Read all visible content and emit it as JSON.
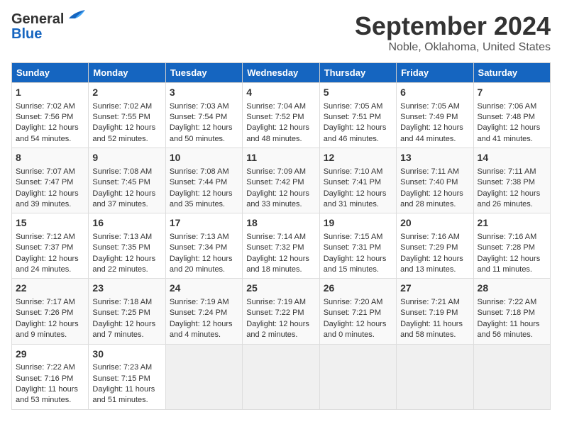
{
  "header": {
    "logo_line1": "General",
    "logo_line2": "Blue",
    "title": "September 2024",
    "subtitle": "Noble, Oklahoma, United States"
  },
  "days_of_week": [
    "Sunday",
    "Monday",
    "Tuesday",
    "Wednesday",
    "Thursday",
    "Friday",
    "Saturday"
  ],
  "weeks": [
    [
      {
        "day": 1,
        "lines": [
          "Sunrise: 7:02 AM",
          "Sunset: 7:56 PM",
          "Daylight: 12 hours",
          "and 54 minutes."
        ]
      },
      {
        "day": 2,
        "lines": [
          "Sunrise: 7:02 AM",
          "Sunset: 7:55 PM",
          "Daylight: 12 hours",
          "and 52 minutes."
        ]
      },
      {
        "day": 3,
        "lines": [
          "Sunrise: 7:03 AM",
          "Sunset: 7:54 PM",
          "Daylight: 12 hours",
          "and 50 minutes."
        ]
      },
      {
        "day": 4,
        "lines": [
          "Sunrise: 7:04 AM",
          "Sunset: 7:52 PM",
          "Daylight: 12 hours",
          "and 48 minutes."
        ]
      },
      {
        "day": 5,
        "lines": [
          "Sunrise: 7:05 AM",
          "Sunset: 7:51 PM",
          "Daylight: 12 hours",
          "and 46 minutes."
        ]
      },
      {
        "day": 6,
        "lines": [
          "Sunrise: 7:05 AM",
          "Sunset: 7:49 PM",
          "Daylight: 12 hours",
          "and 44 minutes."
        ]
      },
      {
        "day": 7,
        "lines": [
          "Sunrise: 7:06 AM",
          "Sunset: 7:48 PM",
          "Daylight: 12 hours",
          "and 41 minutes."
        ]
      }
    ],
    [
      {
        "day": 8,
        "lines": [
          "Sunrise: 7:07 AM",
          "Sunset: 7:47 PM",
          "Daylight: 12 hours",
          "and 39 minutes."
        ]
      },
      {
        "day": 9,
        "lines": [
          "Sunrise: 7:08 AM",
          "Sunset: 7:45 PM",
          "Daylight: 12 hours",
          "and 37 minutes."
        ]
      },
      {
        "day": 10,
        "lines": [
          "Sunrise: 7:08 AM",
          "Sunset: 7:44 PM",
          "Daylight: 12 hours",
          "and 35 minutes."
        ]
      },
      {
        "day": 11,
        "lines": [
          "Sunrise: 7:09 AM",
          "Sunset: 7:42 PM",
          "Daylight: 12 hours",
          "and 33 minutes."
        ]
      },
      {
        "day": 12,
        "lines": [
          "Sunrise: 7:10 AM",
          "Sunset: 7:41 PM",
          "Daylight: 12 hours",
          "and 31 minutes."
        ]
      },
      {
        "day": 13,
        "lines": [
          "Sunrise: 7:11 AM",
          "Sunset: 7:40 PM",
          "Daylight: 12 hours",
          "and 28 minutes."
        ]
      },
      {
        "day": 14,
        "lines": [
          "Sunrise: 7:11 AM",
          "Sunset: 7:38 PM",
          "Daylight: 12 hours",
          "and 26 minutes."
        ]
      }
    ],
    [
      {
        "day": 15,
        "lines": [
          "Sunrise: 7:12 AM",
          "Sunset: 7:37 PM",
          "Daylight: 12 hours",
          "and 24 minutes."
        ]
      },
      {
        "day": 16,
        "lines": [
          "Sunrise: 7:13 AM",
          "Sunset: 7:35 PM",
          "Daylight: 12 hours",
          "and 22 minutes."
        ]
      },
      {
        "day": 17,
        "lines": [
          "Sunrise: 7:13 AM",
          "Sunset: 7:34 PM",
          "Daylight: 12 hours",
          "and 20 minutes."
        ]
      },
      {
        "day": 18,
        "lines": [
          "Sunrise: 7:14 AM",
          "Sunset: 7:32 PM",
          "Daylight: 12 hours",
          "and 18 minutes."
        ]
      },
      {
        "day": 19,
        "lines": [
          "Sunrise: 7:15 AM",
          "Sunset: 7:31 PM",
          "Daylight: 12 hours",
          "and 15 minutes."
        ]
      },
      {
        "day": 20,
        "lines": [
          "Sunrise: 7:16 AM",
          "Sunset: 7:29 PM",
          "Daylight: 12 hours",
          "and 13 minutes."
        ]
      },
      {
        "day": 21,
        "lines": [
          "Sunrise: 7:16 AM",
          "Sunset: 7:28 PM",
          "Daylight: 12 hours",
          "and 11 minutes."
        ]
      }
    ],
    [
      {
        "day": 22,
        "lines": [
          "Sunrise: 7:17 AM",
          "Sunset: 7:26 PM",
          "Daylight: 12 hours",
          "and 9 minutes."
        ]
      },
      {
        "day": 23,
        "lines": [
          "Sunrise: 7:18 AM",
          "Sunset: 7:25 PM",
          "Daylight: 12 hours",
          "and 7 minutes."
        ]
      },
      {
        "day": 24,
        "lines": [
          "Sunrise: 7:19 AM",
          "Sunset: 7:24 PM",
          "Daylight: 12 hours",
          "and 4 minutes."
        ]
      },
      {
        "day": 25,
        "lines": [
          "Sunrise: 7:19 AM",
          "Sunset: 7:22 PM",
          "Daylight: 12 hours",
          "and 2 minutes."
        ]
      },
      {
        "day": 26,
        "lines": [
          "Sunrise: 7:20 AM",
          "Sunset: 7:21 PM",
          "Daylight: 12 hours",
          "and 0 minutes."
        ]
      },
      {
        "day": 27,
        "lines": [
          "Sunrise: 7:21 AM",
          "Sunset: 7:19 PM",
          "Daylight: 11 hours",
          "and 58 minutes."
        ]
      },
      {
        "day": 28,
        "lines": [
          "Sunrise: 7:22 AM",
          "Sunset: 7:18 PM",
          "Daylight: 11 hours",
          "and 56 minutes."
        ]
      }
    ],
    [
      {
        "day": 29,
        "lines": [
          "Sunrise: 7:22 AM",
          "Sunset: 7:16 PM",
          "Daylight: 11 hours",
          "and 53 minutes."
        ]
      },
      {
        "day": 30,
        "lines": [
          "Sunrise: 7:23 AM",
          "Sunset: 7:15 PM",
          "Daylight: 11 hours",
          "and 51 minutes."
        ]
      },
      null,
      null,
      null,
      null,
      null
    ]
  ]
}
